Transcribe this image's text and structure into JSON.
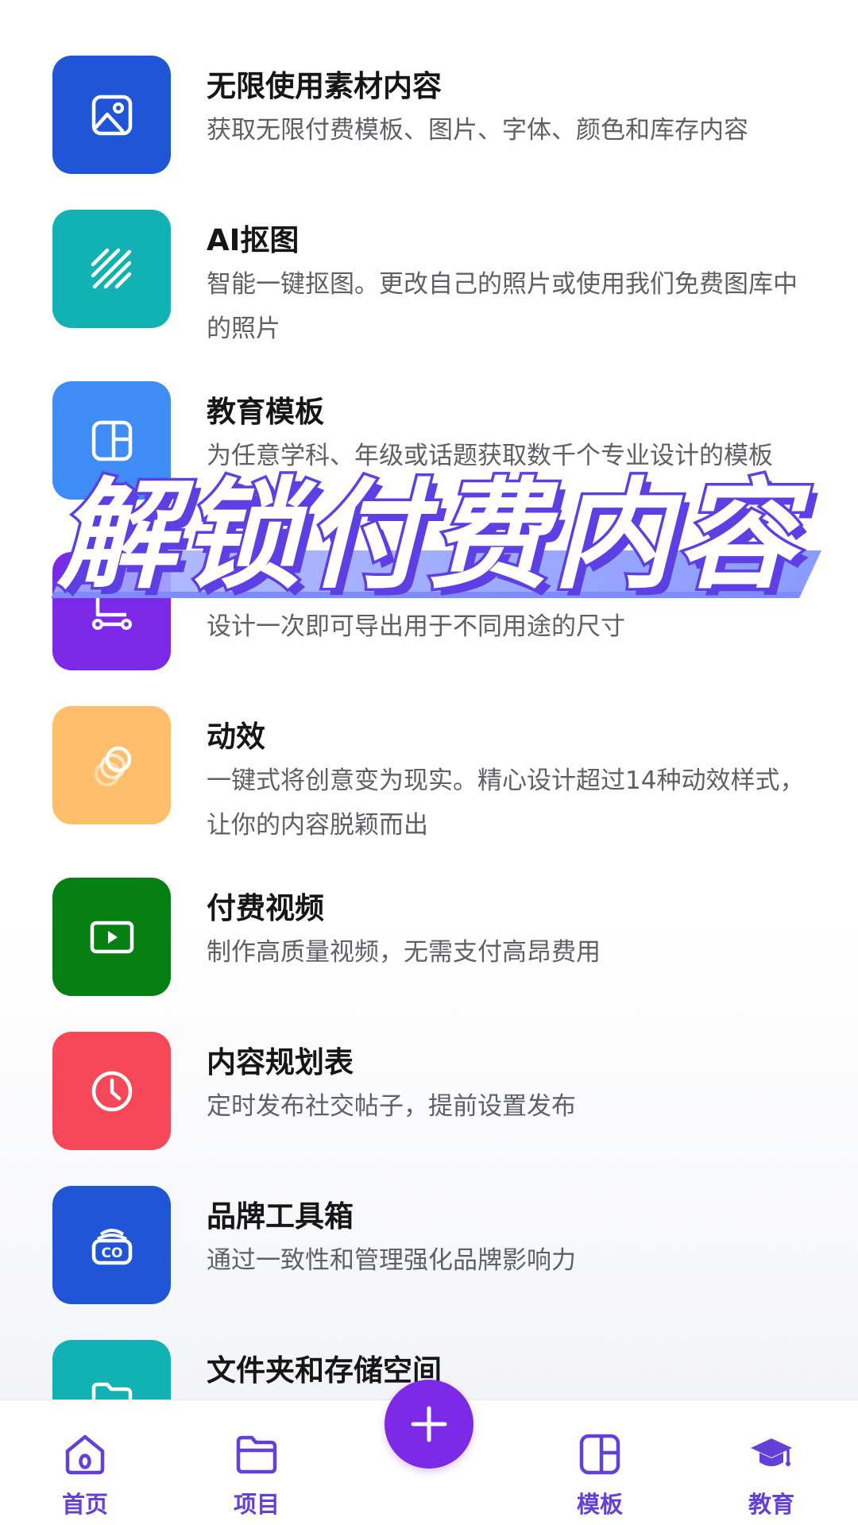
{
  "features": [
    {
      "title": "无限使用素材内容",
      "desc": "获取无限付费模板、图片、字体、颜色和库存内容",
      "icon": "image-icon",
      "color": "#1f55d6"
    },
    {
      "title": "AI抠图",
      "desc": "智能一键抠图。更改自己的照片或使用我们免费图库中的照片",
      "icon": "stripes-icon",
      "color": "#12b2b4"
    },
    {
      "title": "教育模板",
      "desc": "为任意学科、年级或话题获取数千个专业设计的模板",
      "icon": "layout-icon",
      "color": "#3f8cf7"
    },
    {
      "title": "",
      "desc": "设计一次即可导出用于不同用途的尺寸",
      "icon": "resize-icon",
      "color": "#7d2ae8"
    },
    {
      "title": "动效",
      "desc": "一键式将创意变为现实。精心设计超过14种动效样式，让你的内容脱颖而出",
      "icon": "circles-icon",
      "color": "#ffbf6a"
    },
    {
      "title": "付费视频",
      "desc": "制作高质量视频，无需支付高昂费用",
      "icon": "play-icon",
      "color": "#087f12"
    },
    {
      "title": "内容规划表",
      "desc": "定时发布社交帖子，提前设置发布",
      "icon": "clock-icon",
      "color": "#f7485a"
    },
    {
      "title": "品牌工具箱",
      "desc": "通过一致性和管理强化品牌影响力",
      "icon": "brand-kit-icon",
      "color": "#1f55d6"
    },
    {
      "title": "文件夹和存储空间",
      "desc": "",
      "icon": "folder-icon",
      "color": "#12b2b4"
    }
  ],
  "promo": {
    "text": "解锁付费内容"
  },
  "nav": {
    "home": "首页",
    "projects": "项目",
    "create": "+",
    "templates": "模板",
    "education": "教育",
    "accent": "#6440d8"
  }
}
